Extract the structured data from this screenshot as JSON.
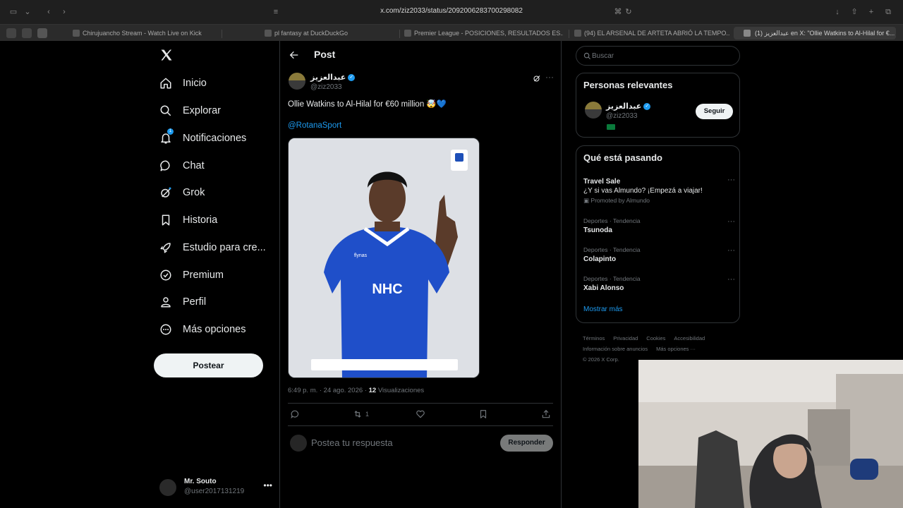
{
  "browser": {
    "url": "x.com/ziz2033/status/2092006283700298082",
    "tabs": [
      {
        "label": "Chirujuancho Stream - Watch Live on Kick"
      },
      {
        "label": "pl fantasy at DuckDuckGo"
      },
      {
        "label": "Premier League - POSICIONES, RESULTADOS ES..."
      },
      {
        "label": "(94) EL ARSENAL DE ARTETA ABRIÓ LA TEMPO..."
      },
      {
        "label": "(1) عبدالعزيز en X: \"Ollie Watkins to Al-Hilal for €..."
      }
    ]
  },
  "nav": {
    "items": [
      {
        "label": "Inicio",
        "icon": "home-icon"
      },
      {
        "label": "Explorar",
        "icon": "search-icon"
      },
      {
        "label": "Notificaciones",
        "icon": "bell-icon",
        "badge": "1"
      },
      {
        "label": "Chat",
        "icon": "chat-icon"
      },
      {
        "label": "Grok",
        "icon": "grok-icon"
      },
      {
        "label": "Historia",
        "icon": "bookmark-icon"
      },
      {
        "label": "Estudio para cre...",
        "icon": "rocket-icon"
      },
      {
        "label": "Premium",
        "icon": "verified-icon"
      },
      {
        "label": "Perfil",
        "icon": "person-icon"
      },
      {
        "label": "Más opciones",
        "icon": "more-circle-icon"
      }
    ],
    "post_label": "Postear",
    "account": {
      "name": "Mr. Souto",
      "handle": "@user2017131219"
    }
  },
  "main": {
    "title": "Post",
    "tweet": {
      "author_name": "عبدالعزيز",
      "author_handle": "@ziz2033",
      "text": "Ollie Watkins to Al-Hilal for €60 million 🤯💙",
      "mention": "@RotanaSport",
      "time": "6:49 p. m. · 24 ago. 2026 · ",
      "views_count": "12",
      "views_label": " Visualizaciones",
      "retweets": "1",
      "image_sponsor": "NHC",
      "image_brand": "flynas"
    },
    "reply": {
      "placeholder": "Postea tu respuesta",
      "button": "Responder"
    }
  },
  "right": {
    "search_placeholder": "Buscar",
    "relevant": {
      "title": "Personas relevantes",
      "name": "عبدالعزيز",
      "handle": "@ziz2033",
      "follow": "Seguir"
    },
    "trends": {
      "title": "Qué está pasando",
      "items": [
        {
          "category": "",
          "name": "Travel Sale",
          "desc": "¿Y si vas Almundo? ¡Empezá a viajar!",
          "promo": "Promoted by Almundo"
        },
        {
          "category": "Deportes · Tendencia",
          "name": "Tsunoda"
        },
        {
          "category": "Deportes · Tendencia",
          "name": "Colapinto"
        },
        {
          "category": "Deportes · Tendencia",
          "name": "Xabi Alonso"
        }
      ],
      "show_more": "Mostrar más"
    },
    "footer": {
      "links": [
        "Términos",
        "Privacidad",
        "Cookies",
        "Accesibilidad",
        "Información sobre anuncios",
        "Más opciones ···"
      ],
      "copyright": "© 2026 X Corp."
    }
  },
  "colors": {
    "accent": "#1d9bf0",
    "background": "#000000",
    "border": "#2f3336",
    "muted": "#71767b"
  }
}
